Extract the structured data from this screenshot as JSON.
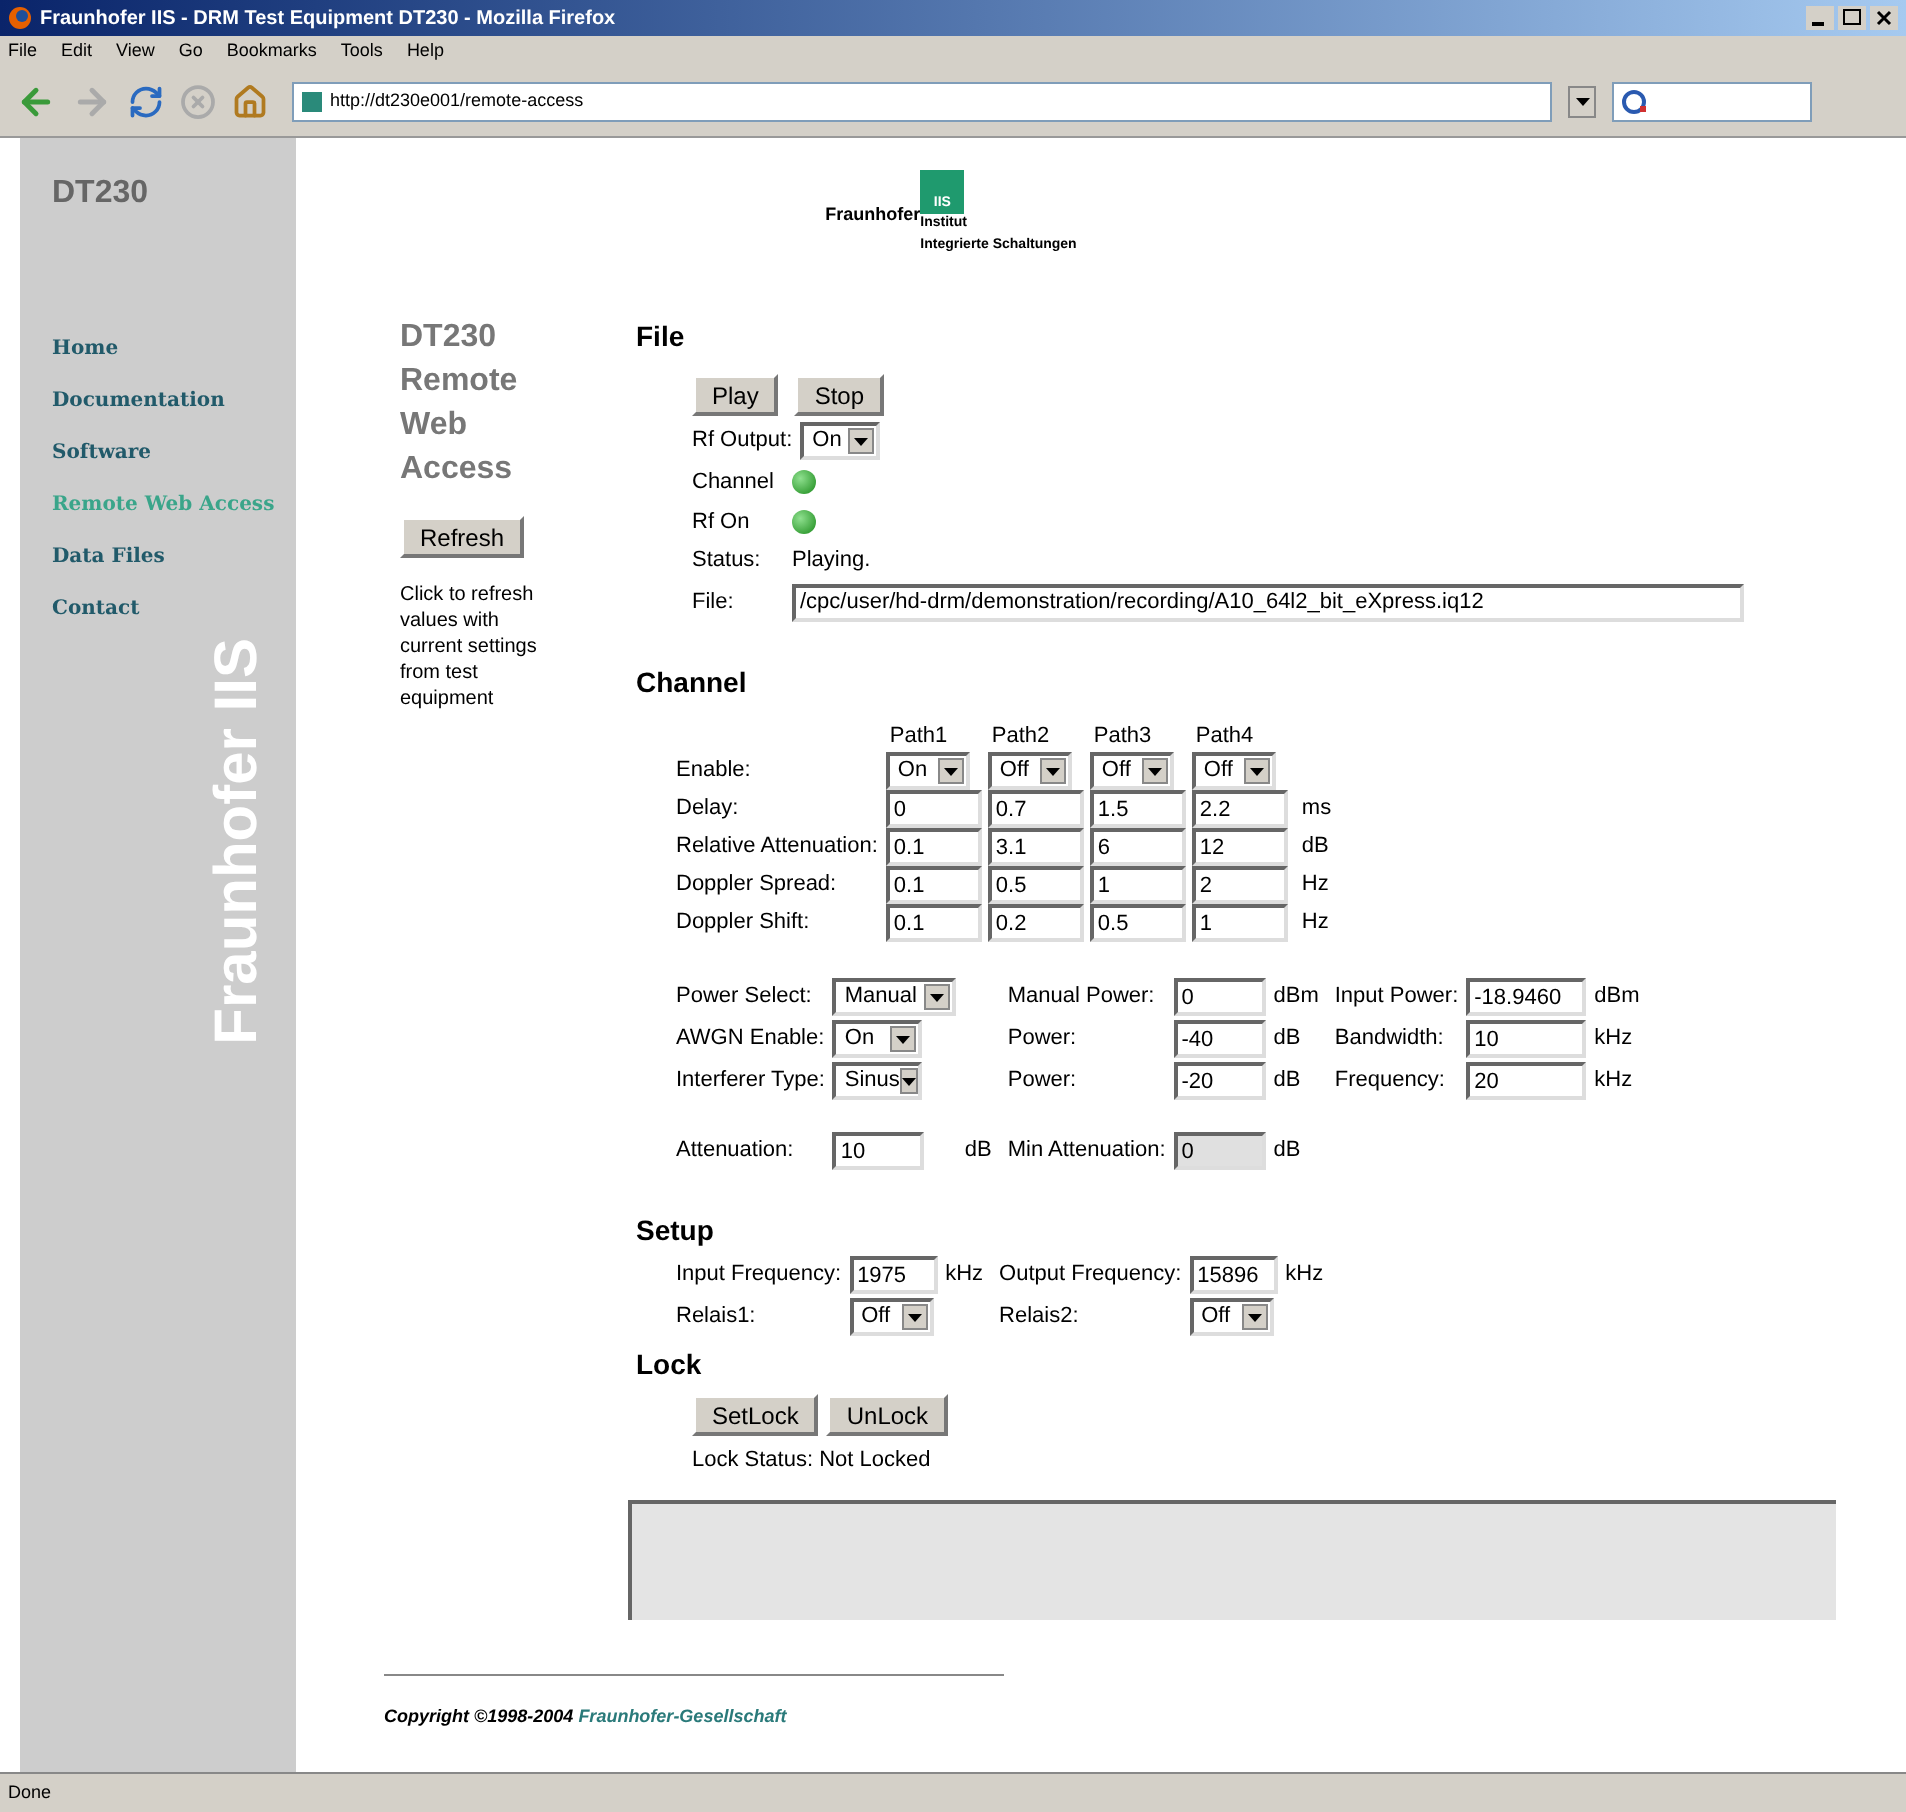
{
  "window": {
    "title": "Fraunhofer IIS - DRM Test Equipment DT230 - Mozilla Firefox"
  },
  "menu": [
    "File",
    "Edit",
    "View",
    "Go",
    "Bookmarks",
    "Tools",
    "Help"
  ],
  "toolbar": {
    "url": "http://dt230e001/remote-access"
  },
  "sidebar": {
    "title": "DT230",
    "watermark": "Fraunhofer IIS",
    "items": [
      {
        "label": "Home",
        "selected": false
      },
      {
        "label": "Documentation",
        "selected": false
      },
      {
        "label": "Software",
        "selected": false
      },
      {
        "label": "Remote Web Access",
        "selected": true
      },
      {
        "label": "Data Files",
        "selected": false
      },
      {
        "label": "Contact",
        "selected": false
      }
    ]
  },
  "logo": {
    "name": "Fraunhofer",
    "badge": "IIS",
    "line1": "Institut",
    "line2": "Integrierte Schaltungen"
  },
  "intro": {
    "heading": "DT230 Remote Web Access",
    "button": "Refresh",
    "text": "Click to refresh values with current settings from test equipment"
  },
  "file": {
    "heading": "File",
    "buttons": [
      "Play",
      "Stop"
    ],
    "rf_output": {
      "label": "Rf Output:",
      "value": "On"
    },
    "indicators": [
      {
        "label": "Channel",
        "on": true
      },
      {
        "label": "Rf On",
        "on": true
      }
    ],
    "status": {
      "label": "Status:",
      "value": "Playing."
    },
    "path": {
      "label": "File:",
      "value": "/cpc/user/hd-drm/demonstration/recording/A10_64l2_bit_eXpress.iq12"
    }
  },
  "channel": {
    "heading": "Channel",
    "columns": [
      "Path1",
      "Path2",
      "Path3",
      "Path4"
    ],
    "rows": [
      {
        "label": "Enable:",
        "kind": "select",
        "values": [
          "On",
          "Off",
          "Off",
          "Off"
        ]
      },
      {
        "label": "Delay:",
        "kind": "input",
        "values": [
          "0",
          "0.7",
          "1.5",
          "2.2"
        ],
        "unit": "ms"
      },
      {
        "label": "Relative Attenuation:",
        "kind": "input",
        "values": [
          "0.1",
          "3.1",
          "6",
          "12"
        ],
        "unit": "dB"
      },
      {
        "label": "Doppler Spread:",
        "kind": "input",
        "values": [
          "0.1",
          "0.5",
          "1",
          "2"
        ],
        "unit": "Hz"
      },
      {
        "label": "Doppler Shift:",
        "kind": "input",
        "values": [
          "0.1",
          "0.2",
          "0.5",
          "1"
        ],
        "unit": "Hz"
      }
    ],
    "power_rows": [
      [
        {
          "label": "Power Select:",
          "kind": "select",
          "value": "Manual"
        },
        {
          "label": "Manual Power:",
          "kind": "input",
          "value": "0",
          "unit": "dBm"
        },
        {
          "label": "Input Power:",
          "kind": "input",
          "value": "-18.9460",
          "unit": "dBm"
        }
      ],
      [
        {
          "label": "AWGN Enable:",
          "kind": "select",
          "value": "On"
        },
        {
          "label": "Power:",
          "kind": "input",
          "value": "-40",
          "unit": "dB"
        },
        {
          "label": "Bandwidth:",
          "kind": "input",
          "value": "10",
          "unit": "kHz"
        }
      ],
      [
        {
          "label": "Interferer Type:",
          "kind": "select",
          "value": "Sinus"
        },
        {
          "label": "Power:",
          "kind": "input",
          "value": "-20",
          "unit": "dB"
        },
        {
          "label": "Frequency:",
          "kind": "input",
          "value": "20",
          "unit": "kHz"
        }
      ]
    ],
    "attenuation": [
      {
        "label": "Attenuation:",
        "value": "10",
        "unit": "dB",
        "disabled": false
      },
      {
        "label": "Min Attenuation:",
        "value": "0",
        "unit": "dB",
        "disabled": true
      }
    ]
  },
  "setup": {
    "heading": "Setup",
    "rows": [
      [
        {
          "label": "Input Frequency:",
          "kind": "input",
          "value": "1975",
          "unit": "kHz"
        },
        {
          "label": "Output Frequency:",
          "kind": "input",
          "value": "15896",
          "unit": "kHz"
        }
      ],
      [
        {
          "label": "Relais1:",
          "kind": "select",
          "value": "Off"
        },
        {
          "label": "Relais2:",
          "kind": "select",
          "value": "Off"
        }
      ]
    ]
  },
  "lock": {
    "heading": "Lock",
    "buttons": [
      "SetLock",
      "UnLock"
    ],
    "status": "Lock Status: Not Locked"
  },
  "footer": {
    "copyright": "Copyright ©1998-2004",
    "link": "Fraunhofer-Gesellschaft"
  },
  "status_bar": "Done"
}
